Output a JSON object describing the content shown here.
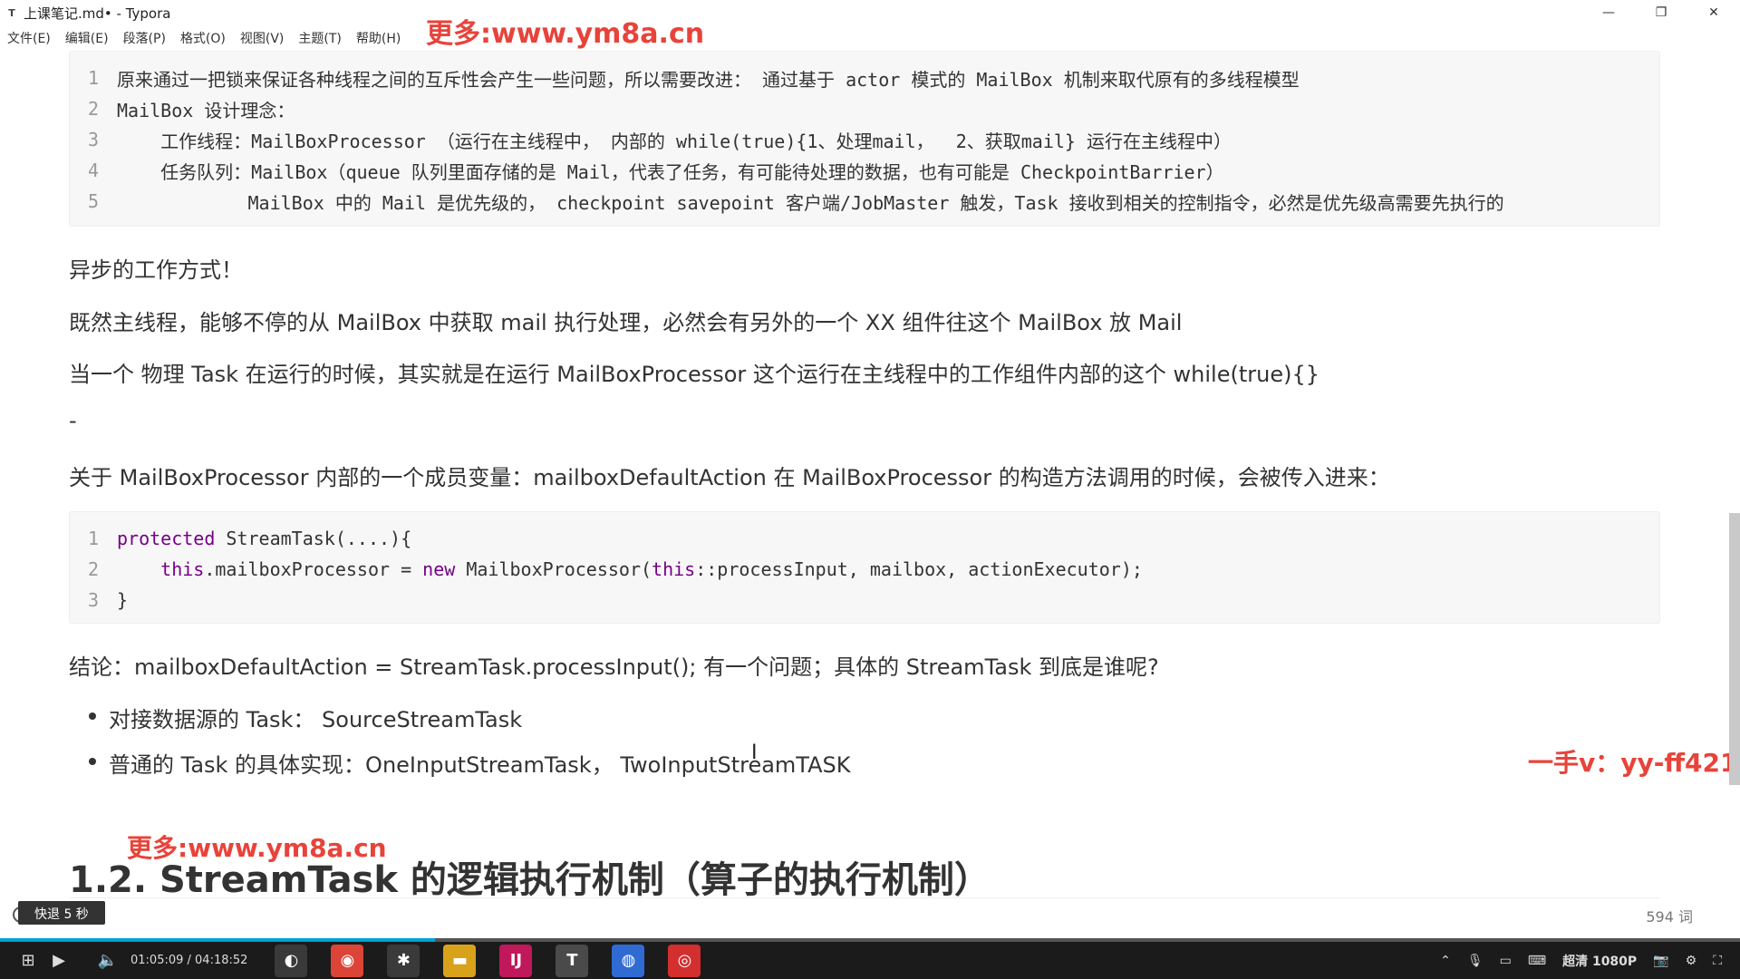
{
  "window": {
    "title": "上课笔记.md• - Typora",
    "app_icon": "T",
    "controls": {
      "minimize": "—",
      "maximize": "❐",
      "close": "✕"
    }
  },
  "menu": [
    "文件(E)",
    "编辑(E)",
    "段落(P)",
    "格式(O)",
    "视图(V)",
    "主题(T)",
    "帮助(H)"
  ],
  "watermarks": {
    "top": "更多:www.ym8a.cn",
    "bottom": "更多:www.ym8a.cn",
    "right": "一手v：yy-ff421"
  },
  "code_block_1": [
    {
      "num": "1",
      "text": "原来通过一把锁来保证各种线程之间的互斥性会产生一些问题，所以需要改进： 通过基于 actor 模式的 MailBox 机制来取代原有的多线程模型"
    },
    {
      "num": "2",
      "text": "MailBox 设计理念："
    },
    {
      "num": "3",
      "text": "    工作线程：MailBoxProcessor （运行在主线程中， 内部的 while(true){1、处理mail，  2、获取mail} 运行在主线程中）"
    },
    {
      "num": "4",
      "text": "    任务队列：MailBox（queue 队列里面存储的是 Mail，代表了任务，有可能待处理的数据，也有可能是 CheckpointBarrier）"
    },
    {
      "num": "5",
      "text": "            MailBox 中的 Mail 是优先级的， checkpoint savepoint 客户端/JobMaster 触发，Task 接收到相关的控制指令，必然是优先级高需要先执行的"
    }
  ],
  "paragraphs": {
    "p1": "异步的工作方式！",
    "p2": "既然主线程，能够不停的从 MailBox 中获取 mail 执行处理，必然会有另外的一个 XX 组件往这个 MailBox 放 Mail",
    "p3": "当一个 物理 Task 在运行的时候，其实就是在运行 MailBoxProcessor 这个运行在主线程中的工作组件内部的这个 while(true){}",
    "p4": "-",
    "p5": "关于 MailBoxProcessor 内部的一个成员变量：mailboxDefaultAction 在 MailBoxProcessor 的构造方法调用的时候，会被传入进来：",
    "p6": "结论：mailboxDefaultAction = StreamTask.processInput(); 有一个问题；具体的 StreamTask 到底是谁呢?"
  },
  "code_block_2": {
    "line_numbers": [
      "1",
      "2",
      "3"
    ],
    "l1_kw": "protected",
    "l1_rest": " StreamTask(....){",
    "l2_this": "this",
    "l2_a": ".mailboxProcessor = ",
    "l2_new": "new",
    "l2_b": " MailboxProcessor(",
    "l2_this2": "this",
    "l2_c": "::processInput, mailbox, actionExecutor);",
    "l3": "}"
  },
  "bullets": [
    "对接数据源的 Task： SourceStreamTask",
    "普通的 Task 的具体实现：OneInputStreamTask， TwoInputStreamTASK"
  ],
  "heading": "1.2. StreamTask 的逻辑执行机制（算子的执行机制）",
  "status": {
    "word_count": "594 词",
    "toast": "快退 5 秒"
  },
  "player": {
    "time": "01:05:09 / 04:18:52",
    "progress": 0.25,
    "quality": "超清 1080P"
  },
  "colors": {
    "watermark": "#e8433a",
    "keyword": "#770088",
    "progress": "#00a1d6"
  }
}
